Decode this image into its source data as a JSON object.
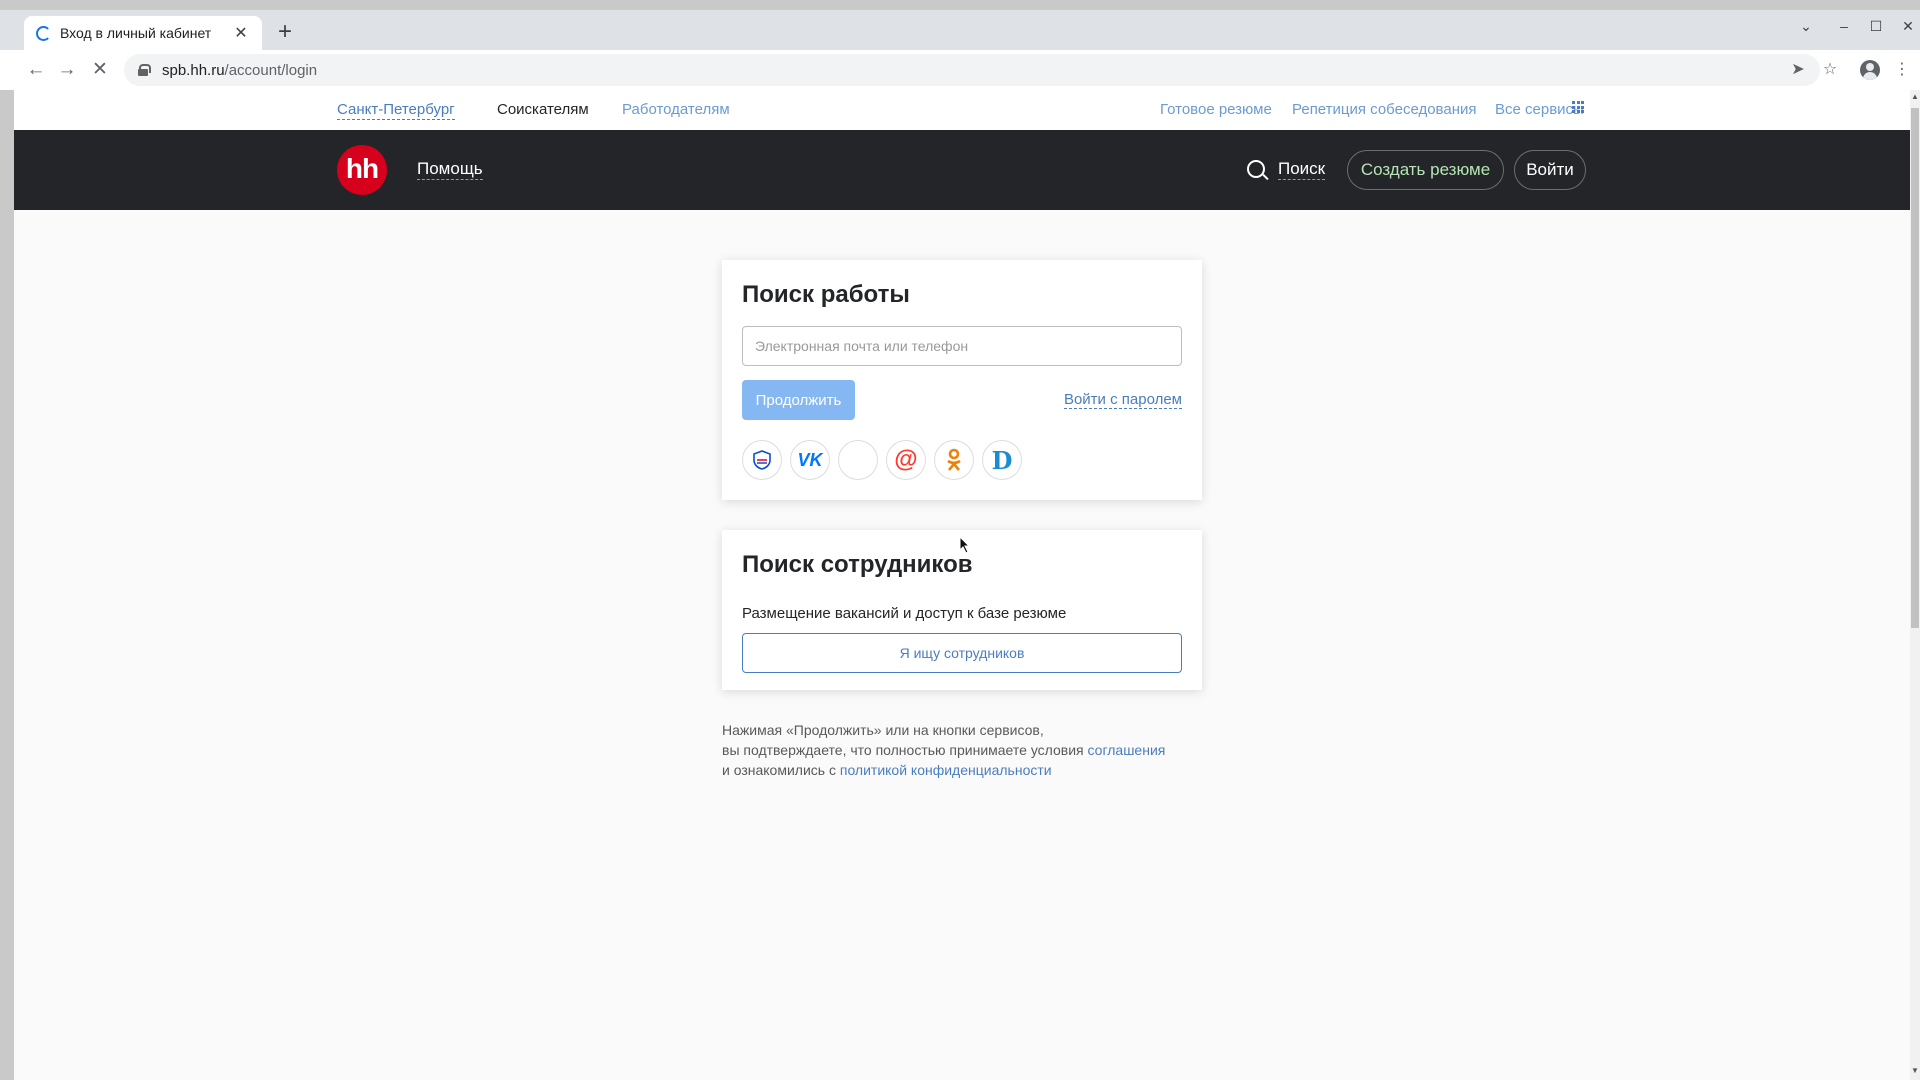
{
  "browser": {
    "tab_title": "Вход в личный кабинет",
    "tab_close": "✕",
    "new_tab": "+",
    "url_host": "spb.hh.ru",
    "url_path": "/account/login",
    "icons": [
      "back-icon",
      "forward-icon",
      "stop-icon",
      "lock-icon",
      "share-icon",
      "star-icon",
      "profile-icon",
      "menu-icon"
    ]
  },
  "topnav": {
    "city": "Санкт-Петербург",
    "seekers": "Соискателям",
    "employers": "Работодателям",
    "ready_resume": "Готовое резюме",
    "interview": "Репетиция собеседования",
    "all_services": "Все сервисы"
  },
  "header": {
    "logo": "hh",
    "help": "Помощь",
    "search": "Поиск",
    "create_resume": "Создать резюме",
    "login": "Войти"
  },
  "job_search": {
    "title": "Поиск работы",
    "input_placeholder": "Электронная почта или телефон",
    "input_value": "",
    "continue": "Продолжить",
    "password_login": "Войти с паролем",
    "socials": [
      "gosuslugi-icon",
      "vk-icon",
      "apple-icon",
      "mailru-icon",
      "odnoklassniki-icon",
      "d-icon"
    ]
  },
  "employee_search": {
    "title": "Поиск сотрудников",
    "description": "Размещение вакансий и доступ к базе резюме",
    "button": "Я ищу сотрудников"
  },
  "legal": {
    "line1": "Нажимая «Продолжить» или на кнопки сервисов,",
    "line2_prefix": "вы подтверждаете, что полностью принимаете условия ",
    "agreement_link": "соглашения",
    "line3_prefix": "и ознакомились с ",
    "privacy_link": "политикой конфиденциальности"
  },
  "colors": {
    "brand_red": "#d6001c",
    "header_bg": "#232529",
    "link_blue": "#4a7dbf",
    "continue_disabled": "#85b7f3"
  }
}
